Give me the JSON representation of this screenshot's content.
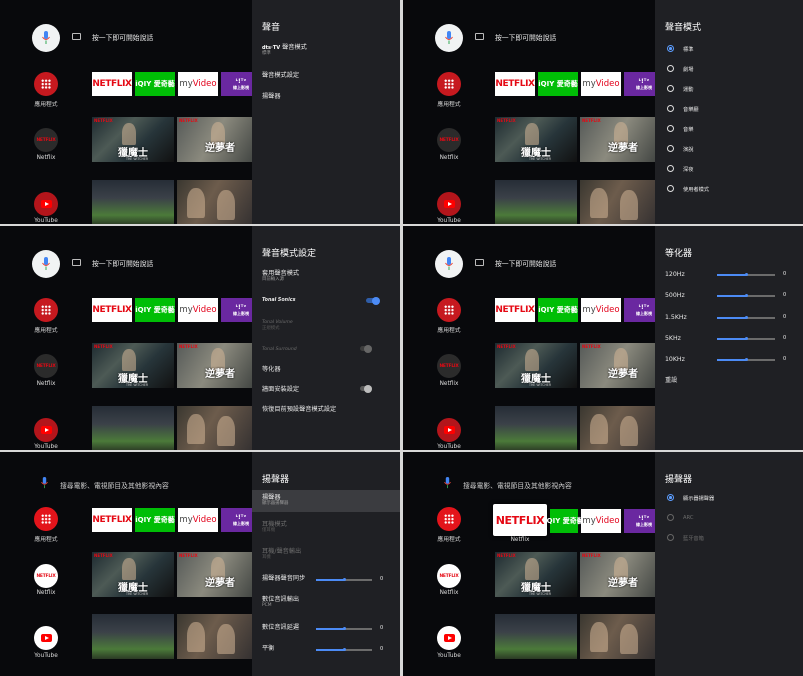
{
  "common": {
    "assistant_hint": "按一下即可開始說話",
    "search_hint": "搜尋電影、電視節目及其他影視內容",
    "apps_label": "應用程式",
    "netflix_label": "Netflix",
    "youtube_label": "YouTube",
    "tile_netflix": "NETFLIX",
    "tile_iqiyi": "iQIY 愛奇藝",
    "tile_myvideo_a": "my",
    "tile_myvideo_b": "Video",
    "tile_friday": "ᴸ!ᵀᵛ",
    "tile_friday_sub": "線上影視",
    "poster1_title": "獵魔士",
    "poster1_sub": "THE WITCHER",
    "poster2_title": "逆夢者",
    "netflix_focus_caption": "Netflix",
    "netflix_mini": "NETFLIX"
  },
  "panel1": {
    "title": "聲音",
    "dolby_brand": "dts·TV",
    "item1": "聲音模式",
    "item1_sub": "標準",
    "item2": "聲音模式設定",
    "item3": "揚聲器"
  },
  "panel2": {
    "title": "聲音模式",
    "options": [
      "標準",
      "劇場",
      "運動",
      "音樂廳",
      "音樂",
      "演說",
      "深夜",
      "使用者模式"
    ],
    "selected": "標準"
  },
  "panel3": {
    "title": "聲音模式設定",
    "item1": "套用聲音模式",
    "item1_sub": "目前輸入源",
    "item2": "Tonal Sonics",
    "item3": "Tonal Volume",
    "item3_sub": "正規模式",
    "item4": "Tonal Surround",
    "item5": "等化器",
    "item6": "牆面安裝設定",
    "item7": "恢復目前預設聲音模式設定",
    "toggle_sonics": true,
    "toggle_surround": false,
    "toggle_wall": false
  },
  "panel4": {
    "title": "等化器",
    "bands": [
      {
        "label": "120Hz",
        "value": "0",
        "level": 0.5
      },
      {
        "label": "500Hz",
        "value": "0",
        "level": 0.5
      },
      {
        "label": "1.5KHz",
        "value": "0",
        "level": 0.5
      },
      {
        "label": "5KHz",
        "value": "0",
        "level": 0.5
      },
      {
        "label": "10KHz",
        "value": "0",
        "level": 0.5
      }
    ],
    "reset": "重設"
  },
  "panel5": {
    "title": "揚聲器",
    "item1": "揚聲器",
    "item1_sub": "顯示器揚聲器",
    "item2": "耳機模式",
    "item2_sub": "僅耳機",
    "item3": "耳機/聲音輸出",
    "item3_sub": "耳機",
    "item4": "揚聲器聲音同步",
    "item4_value": "0",
    "item4_level": 0.5,
    "item5": "數位音訊輸出",
    "item5_sub": "PCM",
    "item6": "數位音訊延遲",
    "item6_value": "0",
    "item6_level": 0.5,
    "item7": "平衡",
    "item7_value": "0",
    "item7_level": 0.5
  },
  "panel6": {
    "title": "揚聲器",
    "options": [
      "顯示器揚聲器",
      "ARC",
      "藍牙音箱"
    ],
    "selected": "顯示器揚聲器"
  },
  "colors": {
    "accent": "#4c8bf5",
    "panel_bg": "#1f2024",
    "netflix_red": "#e50914",
    "iqiyi_green": "#00be06",
    "friday_purple": "#6a28a0"
  }
}
